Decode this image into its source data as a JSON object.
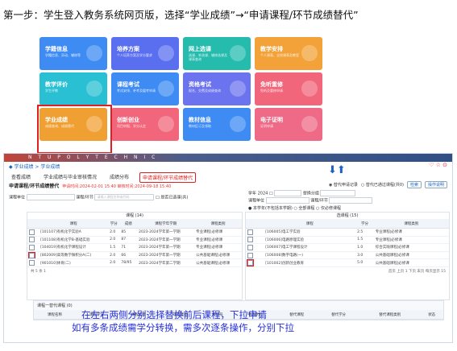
{
  "heading": "第一步：学生登入教务系统网页版，选择“学业成绩”→“申请课程/环节成绩替代”",
  "tiles": [
    {
      "title": "学籍信息",
      "sub": "学籍信息、异动、辅修等",
      "color": "#3d8bf3"
    },
    {
      "title": "培养方案",
      "sub": "个人培养方案及学分要求",
      "color": "#5a6ff0"
    },
    {
      "title": "网上选课",
      "sub": "选课、补选课、辅修选课及课表查询",
      "color": "#25bcae"
    },
    {
      "title": "教学安排",
      "sub": "个人课表、全校课表及教室",
      "color": "#f2a238"
    },
    {
      "title": "教学评价",
      "sub": "学生评教",
      "color": "#28c0d2"
    },
    {
      "title": "课程考试",
      "sub": "考试安排、补考及缓考申请",
      "color": "#3d8bf3"
    },
    {
      "title": "资格考试",
      "sub": "报名、交费及成绩查询",
      "color": "#6b73ee"
    },
    {
      "title": "免听重修",
      "sub": "免听及重修申请",
      "color": "#f1667b"
    },
    {
      "title": "学业成绩",
      "sub": "成绩查询、成绩替代",
      "color": "#f0a033"
    },
    {
      "title": "创新创业",
      "sub": "项目申报、学分认定",
      "color": "#f1667b"
    },
    {
      "title": "教材信息",
      "sub": "教材征订及领取",
      "color": "#3d8bf3"
    },
    {
      "title": "电子证明",
      "sub": "证明申请",
      "color": "#ee6a86"
    }
  ],
  "banner": "N T U   P O L Y T E C H N I C",
  "breadcrumb": "◆ 学业成绩 > 学业成绩",
  "window_icons": "♡ ☆ ⊙",
  "tabs": [
    "查看成绩",
    "学业成绩与毕业审核情况",
    "成绩分布",
    "申请课程/环节成绩替代"
  ],
  "subheader": "申请课程/环节成绩替代",
  "period": "申请时间:2024-02-01 15:40  审核时间:2024-09-18 15:40",
  "radio1": "◉ 替代申请记录",
  "radio2": "○ 替代已通过课程(共0)",
  "btn_query": "检索",
  "btn_help": "操作说明",
  "left_filter": {
    "label1": "课程单位",
    "label2": "课程/环节",
    "placeholder": "请输入课程名称或代码",
    "checkbox": "□ 是否已选课(共)"
  },
  "right_filter": {
    "year": "学年 2024 □",
    "group": "替换分组",
    "reuse": "● 本学年(不包括本学期)  ○ 全部课程  ○ 仅必修课程",
    "unit": "课程单位",
    "course": "课程/环节"
  },
  "left_table": {
    "title": "课程 (14)",
    "headers": [
      "课程",
      "学分",
      "成绩",
      "课程学年学期",
      "课程类别"
    ],
    "rows": [
      [
        "[101107]有机化学实验A",
        "2.0",
        "85",
        "2023-2024学年第一学期",
        "专业课程|必修课"
      ],
      [
        "[101108]有机化学B-基础实验",
        "2.0",
        "87",
        "2023-2024学年第一学期",
        "专业课程|必修课"
      ],
      [
        "[104019]有机化学课程设计",
        "1.5",
        "71",
        "2023-2024学年第一学期",
        "专业课程|必修课"
      ],
      [
        "[802009]高等数学微积分A(二)",
        "2.0",
        "66",
        "2023-2024学年第一学期",
        "公共基础课程|必修课"
      ],
      [
        "[901010]体育(二)",
        "2.0",
        "78/95",
        "2023-2024学年第二学期",
        "公共基础课程|必修课"
      ]
    ],
    "pager": "共 5 条  1"
  },
  "right_table": {
    "title": "选课程 (15)",
    "headers": [
      "课程",
      "学分",
      "课程类别"
    ],
    "rows": [
      [
        "[106005]电工学实验",
        "2.5",
        "专业课程|必修课"
      ],
      [
        "[106006]电路原理实验",
        "1.5",
        "专业课程|必修课"
      ],
      [
        "[106007]电工学课程设计",
        "1.0",
        "综合实践课程|必修课"
      ],
      [
        "[106008]数字电路(一)",
        "3.0",
        "公共基础课程|必修课"
      ],
      [
        "[101002]创新创业教育",
        "5.0",
        "公共基础课程|必修课"
      ]
    ],
    "pager": "首页 上页 1 下页 末页 每页显示 15"
  },
  "arrows": "⬇⬆",
  "bottom": {
    "title": "课程一替代课程 (0)",
    "headers": [
      "课程名称",
      "课程学分",
      "课程成绩",
      "课程类别",
      "申请号",
      "申请原因",
      "替代课程",
      "替代学分",
      "替代课程类别",
      "状态"
    ]
  },
  "note_line1": "在左右两侧分别选择替换前后课程，下拉申请",
  "note_line2": "如有多条成绩需学分转换，需多次逐条操作，分别下拉"
}
